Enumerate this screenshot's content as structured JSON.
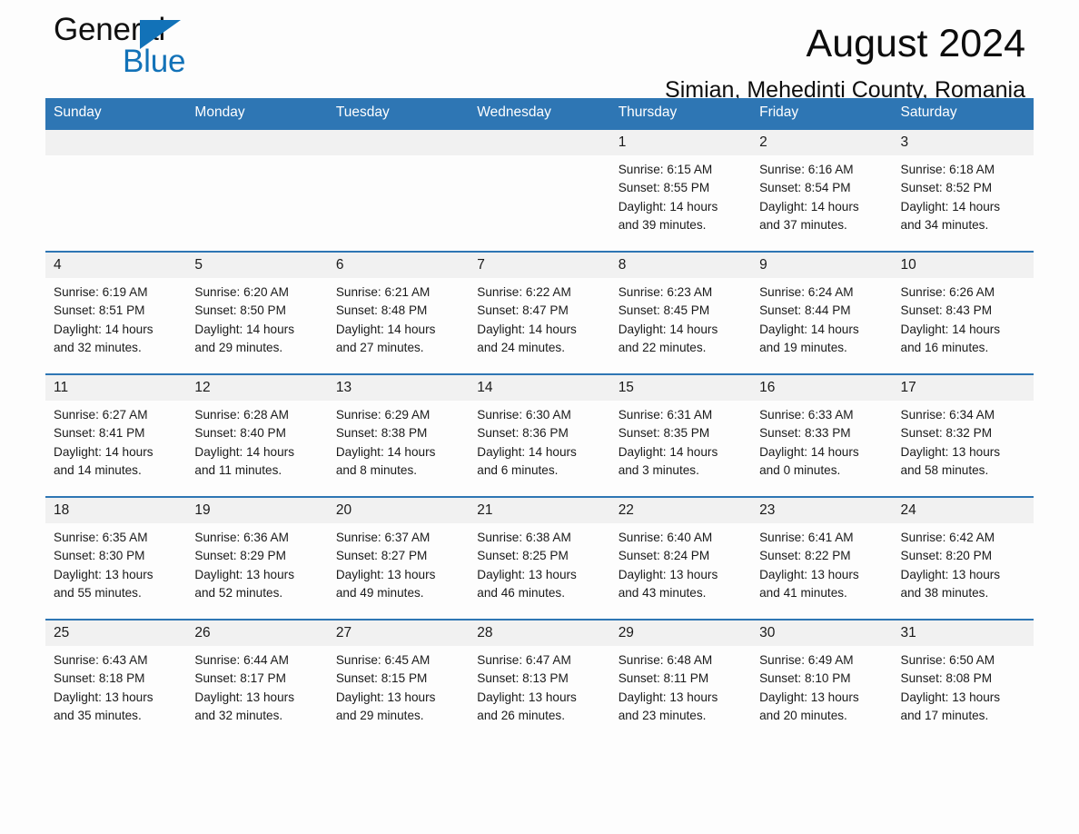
{
  "brand": {
    "name_part1": "General",
    "name_part2": "Blue",
    "triangle_color": "#1272b8"
  },
  "header": {
    "month_title": "August 2024",
    "location": "Simian, Mehedinti County, Romania"
  },
  "theme": {
    "header_blue": "#2e76b4",
    "day_band_gray": "#f1f1f1",
    "page_background": "#fdfdfd",
    "text_color": "#1a1a1a"
  },
  "calendar": {
    "weekdays": [
      "Sunday",
      "Monday",
      "Tuesday",
      "Wednesday",
      "Thursday",
      "Friday",
      "Saturday"
    ],
    "weeks": [
      [
        {
          "day": "",
          "lines": []
        },
        {
          "day": "",
          "lines": []
        },
        {
          "day": "",
          "lines": []
        },
        {
          "day": "",
          "lines": []
        },
        {
          "day": "1",
          "lines": [
            "Sunrise: 6:15 AM",
            "Sunset: 8:55 PM",
            "Daylight: 14 hours",
            "and 39 minutes."
          ]
        },
        {
          "day": "2",
          "lines": [
            "Sunrise: 6:16 AM",
            "Sunset: 8:54 PM",
            "Daylight: 14 hours",
            "and 37 minutes."
          ]
        },
        {
          "day": "3",
          "lines": [
            "Sunrise: 6:18 AM",
            "Sunset: 8:52 PM",
            "Daylight: 14 hours",
            "and 34 minutes."
          ]
        }
      ],
      [
        {
          "day": "4",
          "lines": [
            "Sunrise: 6:19 AM",
            "Sunset: 8:51 PM",
            "Daylight: 14 hours",
            "and 32 minutes."
          ]
        },
        {
          "day": "5",
          "lines": [
            "Sunrise: 6:20 AM",
            "Sunset: 8:50 PM",
            "Daylight: 14 hours",
            "and 29 minutes."
          ]
        },
        {
          "day": "6",
          "lines": [
            "Sunrise: 6:21 AM",
            "Sunset: 8:48 PM",
            "Daylight: 14 hours",
            "and 27 minutes."
          ]
        },
        {
          "day": "7",
          "lines": [
            "Sunrise: 6:22 AM",
            "Sunset: 8:47 PM",
            "Daylight: 14 hours",
            "and 24 minutes."
          ]
        },
        {
          "day": "8",
          "lines": [
            "Sunrise: 6:23 AM",
            "Sunset: 8:45 PM",
            "Daylight: 14 hours",
            "and 22 minutes."
          ]
        },
        {
          "day": "9",
          "lines": [
            "Sunrise: 6:24 AM",
            "Sunset: 8:44 PM",
            "Daylight: 14 hours",
            "and 19 minutes."
          ]
        },
        {
          "day": "10",
          "lines": [
            "Sunrise: 6:26 AM",
            "Sunset: 8:43 PM",
            "Daylight: 14 hours",
            "and 16 minutes."
          ]
        }
      ],
      [
        {
          "day": "11",
          "lines": [
            "Sunrise: 6:27 AM",
            "Sunset: 8:41 PM",
            "Daylight: 14 hours",
            "and 14 minutes."
          ]
        },
        {
          "day": "12",
          "lines": [
            "Sunrise: 6:28 AM",
            "Sunset: 8:40 PM",
            "Daylight: 14 hours",
            "and 11 minutes."
          ]
        },
        {
          "day": "13",
          "lines": [
            "Sunrise: 6:29 AM",
            "Sunset: 8:38 PM",
            "Daylight: 14 hours",
            "and 8 minutes."
          ]
        },
        {
          "day": "14",
          "lines": [
            "Sunrise: 6:30 AM",
            "Sunset: 8:36 PM",
            "Daylight: 14 hours",
            "and 6 minutes."
          ]
        },
        {
          "day": "15",
          "lines": [
            "Sunrise: 6:31 AM",
            "Sunset: 8:35 PM",
            "Daylight: 14 hours",
            "and 3 minutes."
          ]
        },
        {
          "day": "16",
          "lines": [
            "Sunrise: 6:33 AM",
            "Sunset: 8:33 PM",
            "Daylight: 14 hours",
            "and 0 minutes."
          ]
        },
        {
          "day": "17",
          "lines": [
            "Sunrise: 6:34 AM",
            "Sunset: 8:32 PM",
            "Daylight: 13 hours",
            "and 58 minutes."
          ]
        }
      ],
      [
        {
          "day": "18",
          "lines": [
            "Sunrise: 6:35 AM",
            "Sunset: 8:30 PM",
            "Daylight: 13 hours",
            "and 55 minutes."
          ]
        },
        {
          "day": "19",
          "lines": [
            "Sunrise: 6:36 AM",
            "Sunset: 8:29 PM",
            "Daylight: 13 hours",
            "and 52 minutes."
          ]
        },
        {
          "day": "20",
          "lines": [
            "Sunrise: 6:37 AM",
            "Sunset: 8:27 PM",
            "Daylight: 13 hours",
            "and 49 minutes."
          ]
        },
        {
          "day": "21",
          "lines": [
            "Sunrise: 6:38 AM",
            "Sunset: 8:25 PM",
            "Daylight: 13 hours",
            "and 46 minutes."
          ]
        },
        {
          "day": "22",
          "lines": [
            "Sunrise: 6:40 AM",
            "Sunset: 8:24 PM",
            "Daylight: 13 hours",
            "and 43 minutes."
          ]
        },
        {
          "day": "23",
          "lines": [
            "Sunrise: 6:41 AM",
            "Sunset: 8:22 PM",
            "Daylight: 13 hours",
            "and 41 minutes."
          ]
        },
        {
          "day": "24",
          "lines": [
            "Sunrise: 6:42 AM",
            "Sunset: 8:20 PM",
            "Daylight: 13 hours",
            "and 38 minutes."
          ]
        }
      ],
      [
        {
          "day": "25",
          "lines": [
            "Sunrise: 6:43 AM",
            "Sunset: 8:18 PM",
            "Daylight: 13 hours",
            "and 35 minutes."
          ]
        },
        {
          "day": "26",
          "lines": [
            "Sunrise: 6:44 AM",
            "Sunset: 8:17 PM",
            "Daylight: 13 hours",
            "and 32 minutes."
          ]
        },
        {
          "day": "27",
          "lines": [
            "Sunrise: 6:45 AM",
            "Sunset: 8:15 PM",
            "Daylight: 13 hours",
            "and 29 minutes."
          ]
        },
        {
          "day": "28",
          "lines": [
            "Sunrise: 6:47 AM",
            "Sunset: 8:13 PM",
            "Daylight: 13 hours",
            "and 26 minutes."
          ]
        },
        {
          "day": "29",
          "lines": [
            "Sunrise: 6:48 AM",
            "Sunset: 8:11 PM",
            "Daylight: 13 hours",
            "and 23 minutes."
          ]
        },
        {
          "day": "30",
          "lines": [
            "Sunrise: 6:49 AM",
            "Sunset: 8:10 PM",
            "Daylight: 13 hours",
            "and 20 minutes."
          ]
        },
        {
          "day": "31",
          "lines": [
            "Sunrise: 6:50 AM",
            "Sunset: 8:08 PM",
            "Daylight: 13 hours",
            "and 17 minutes."
          ]
        }
      ]
    ]
  }
}
